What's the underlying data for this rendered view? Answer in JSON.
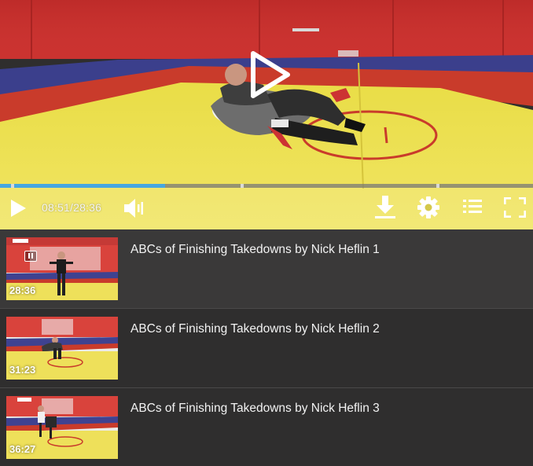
{
  "player": {
    "current_time": "08:51",
    "duration": "28:36",
    "time_display": "08:51/28:36",
    "progress_fraction": 0.309,
    "chapter_markers_fraction": [
      0.021,
      0.452,
      0.818
    ],
    "accent_color": "#46a7e0"
  },
  "controls": {
    "icons": [
      "play-icon",
      "volume-icon",
      "download-icon",
      "gear-icon",
      "playlist-icon",
      "fullscreen-icon"
    ]
  },
  "playlist": {
    "items": [
      {
        "title": "ABCs of Finishing Takedowns by Nick Heflin 1",
        "duration": "28:36",
        "active": true
      },
      {
        "title": "ABCs of Finishing Takedowns by Nick Heflin 2",
        "duration": "31:23",
        "active": false
      },
      {
        "title": "ABCs of Finishing Takedowns by Nick Heflin 3",
        "duration": "36:27",
        "active": false
      }
    ]
  }
}
